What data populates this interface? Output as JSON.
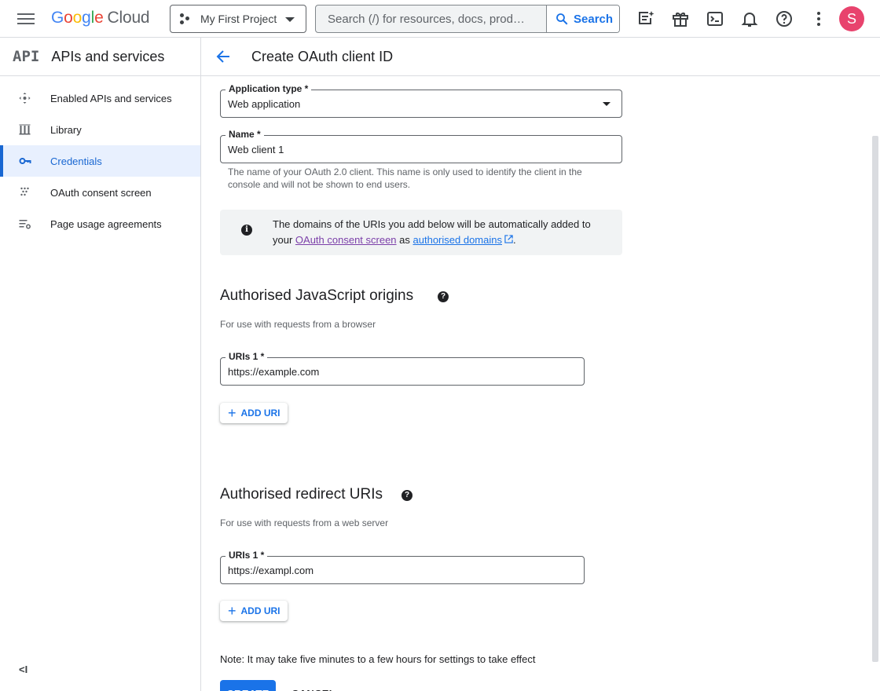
{
  "topbar": {
    "logo_letters": [
      "G",
      "o",
      "o",
      "g",
      "l",
      "e"
    ],
    "logo_cloud": "Cloud",
    "project_name": "My First Project",
    "search_placeholder": "Search (/) for resources, docs, prod…",
    "search_button": "Search",
    "avatar_letter": "S"
  },
  "sidebar": {
    "logo": "API",
    "title": "APIs and services",
    "items": [
      {
        "label": "Enabled APIs and services",
        "icon": "hub-icon"
      },
      {
        "label": "Library",
        "icon": "library-icon"
      },
      {
        "label": "Credentials",
        "icon": "key-icon",
        "active": true
      },
      {
        "label": "OAuth consent screen",
        "icon": "consent-icon"
      },
      {
        "label": "Page usage agreements",
        "icon": "settings-list-icon"
      }
    ],
    "collapse": "<I"
  },
  "header": {
    "title": "Create OAuth client ID"
  },
  "form": {
    "app_type_label": "Application type *",
    "app_type_value": "Web application",
    "name_label": "Name *",
    "name_value": "Web client 1",
    "name_hint": "The name of your OAuth 2.0 client. This name is only used to identify the client in the console and will not be shown to end users.",
    "info_prefix": "The domains of the URIs you add below will be automatically added to your ",
    "info_link1": "OAuth consent screen",
    "info_mid": " as ",
    "info_link2": "authorised domains",
    "info_suffix": ".",
    "js_origins": {
      "title": "Authorised JavaScript origins",
      "hint": "For use with requests from a browser",
      "uri_label": "URIs 1 *",
      "uri_value": "https://example.com",
      "add_label": "ADD URI"
    },
    "redirect": {
      "title": "Authorised redirect URIs",
      "hint": "For use with requests from a web server",
      "uri_label": "URIs 1 *",
      "uri_value": "https://exampl.com",
      "add_label": "ADD URI"
    },
    "note": "Note: It may take five minutes to a few hours for settings to take effect",
    "create_label": "CREATE",
    "cancel_label": "CANCEL"
  },
  "colors": {
    "accent": "#1a73e8",
    "active_bg": "#e8f0fe",
    "avatar": "#e8436d"
  }
}
